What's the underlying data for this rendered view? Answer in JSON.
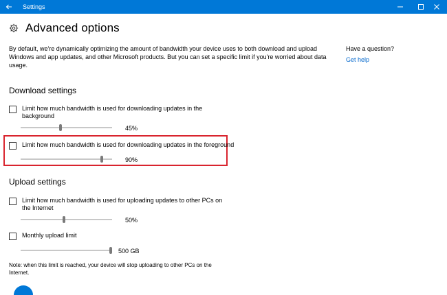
{
  "titlebar": {
    "title": "Settings"
  },
  "header": {
    "title": "Advanced options"
  },
  "intro": "By default, we're dynamically optimizing the amount of bandwidth your device uses to both download and upload Windows and app updates, and other Microsoft products. But you can set a specific limit if you're worried about data usage.",
  "aside": {
    "question": "Have a question?",
    "link": "Get help"
  },
  "download": {
    "title": "Download settings",
    "background": {
      "label": "Limit how much bandwidth is used for downloading updates in the background",
      "value_text": "45%",
      "value": 45
    },
    "foreground": {
      "label": "Limit how much bandwidth is used for downloading updates in the foreground",
      "value_text": "90%",
      "value": 90
    }
  },
  "upload": {
    "title": "Upload settings",
    "limit": {
      "label": "Limit how much bandwidth is used for uploading updates to other PCs on the Internet",
      "value_text": "50%",
      "value": 50
    },
    "monthly": {
      "label": "Monthly upload limit",
      "value_text": "500 GB",
      "value": 100
    }
  },
  "note": "Note: when this limit is reached, your device will stop uploading to other PCs on the Internet.",
  "colors": {
    "accent": "#0078d7",
    "highlight": "#d9242e",
    "link": "#0066cc"
  }
}
